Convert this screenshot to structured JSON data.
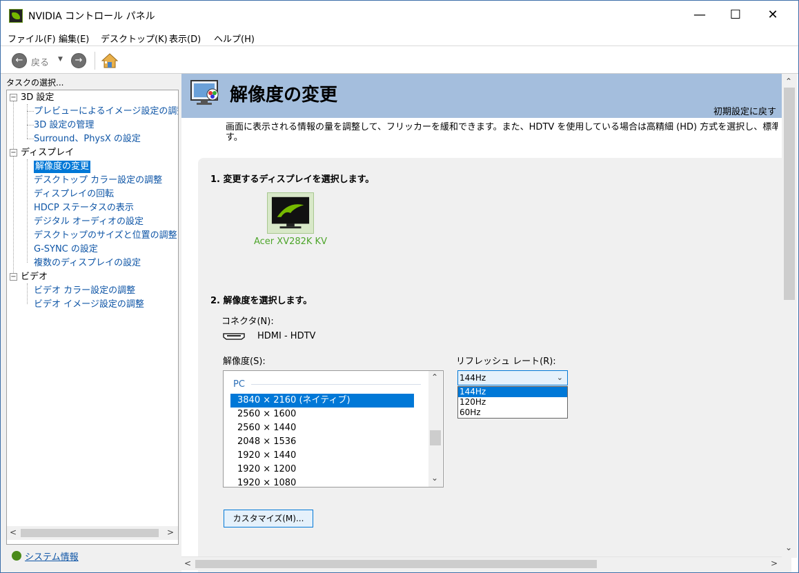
{
  "window": {
    "title": "NVIDIA コントロール パネル",
    "min_glyph": "—",
    "max_glyph": "☐",
    "close_glyph": "✕"
  },
  "menu": [
    "ファイル(F)",
    "編集(E)",
    "デスクトップ(K)",
    "表示(D)",
    "ヘルプ(H)"
  ],
  "toolbar": {
    "back_label": "戻る",
    "back_glyph": "←",
    "forward_glyph": "→",
    "dropdown_glyph": "▼",
    "icons": [
      "back-icon",
      "forward-icon",
      "home-icon"
    ]
  },
  "sidebar": {
    "caption": "タスクの選択...",
    "categories": [
      {
        "label": "3D 設定",
        "items": [
          "プレビューによるイメージ設定の調整",
          "3D 設定の管理",
          "Surround、PhysX の設定"
        ]
      },
      {
        "label": "ディスプレイ",
        "items": [
          "解像度の変更",
          "デスクトップ カラー設定の調整",
          "ディスプレイの回転",
          "HDCP ステータスの表示",
          "デジタル オーディオの設定",
          "デスクトップのサイズと位置の調整",
          "G-SYNC の設定",
          "複数のディスプレイの設定"
        ]
      },
      {
        "label": "ビデオ",
        "items": [
          "ビデオ カラー設定の調整",
          "ビデオ イメージ設定の調整"
        ]
      }
    ],
    "selected_item": "解像度の変更",
    "expand_glyph": "−",
    "system_info_label": "システム情報"
  },
  "main": {
    "title": "解像度の変更",
    "restore_link": "初期設定に戻す",
    "description": "画面に表示される情報の量を調整して、フリッカーを緩和できます。また、HDTV を使用している場合は高精細 (HD) 方式を選択し、標準",
    "description_cont": "す。",
    "step1": "1. 変更するディスプレイを選択します。",
    "display_name": "Acer XV282K KV",
    "step2": "2. 解像度を選択します。",
    "connector_label": "コネクタ(N):",
    "connector_value": "HDMI - HDTV",
    "resolution_label": "解像度(S):",
    "resolution_group": "PC",
    "resolutions": [
      "3840 × 2160 (ネイティブ)",
      "2560 × 1600",
      "2560 × 1440",
      "2048 × 1536",
      "1920 × 1440",
      "1920 × 1200",
      "1920 × 1080"
    ],
    "selected_resolution": "3840 × 2160 (ネイティブ)",
    "refresh_label": "リフレッシュ レート(R):",
    "refresh_value": "144Hz",
    "refresh_options": [
      "144Hz",
      "120Hz",
      "60Hz"
    ],
    "customize_button": "カスタマイズ(M)..."
  },
  "colors": {
    "accent": "#0078d7",
    "header_band": "#a4bedd",
    "link": "#0e55a6",
    "nvidia_green": "#76b900",
    "display_name": "#4da52a"
  }
}
